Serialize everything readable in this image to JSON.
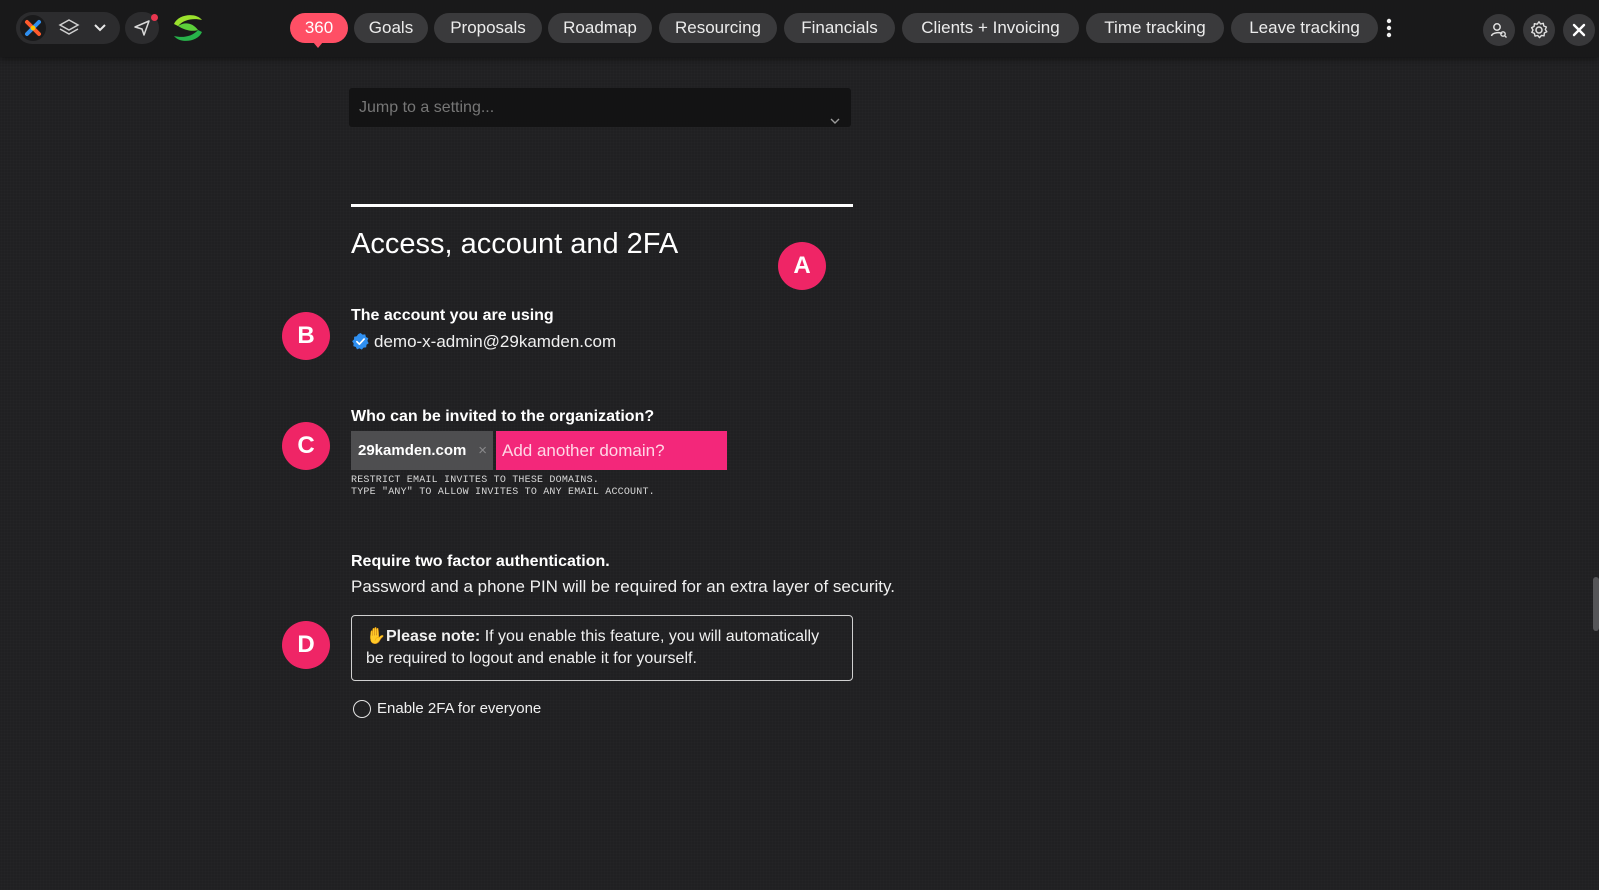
{
  "topbar": {
    "nav": [
      {
        "label": "360",
        "active": true
      },
      {
        "label": "Goals",
        "active": false
      },
      {
        "label": "Proposals",
        "active": false
      },
      {
        "label": "Roadmap",
        "active": false
      },
      {
        "label": "Resourcing",
        "active": false
      },
      {
        "label": "Financials",
        "active": false
      },
      {
        "label": "Clients + Invoicing",
        "active": false
      },
      {
        "label": "Time tracking",
        "active": false
      },
      {
        "label": "Leave tracking",
        "active": false
      }
    ],
    "icons": [
      "brand-x-icon",
      "layers-icon",
      "chevron-down-icon",
      "send-icon",
      "logo-icon",
      "more-vertical-icon",
      "user-search-icon",
      "gear-icon",
      "close-icon"
    ],
    "colors": {
      "active_pill": "#ff4f65",
      "pill": "#3a3a3c",
      "notification": "#e8364f"
    }
  },
  "settings": {
    "jump_placeholder": "Jump to a setting...",
    "section_title": "Access, account and 2FA",
    "markers": {
      "a": "A",
      "b": "B",
      "c": "C",
      "d": "D"
    },
    "account": {
      "label": "The account you are using",
      "email": "demo-x-admin@29kamden.com"
    },
    "invites": {
      "label": "Who can be invited to the organization?",
      "domain_tag": "29kamden.com",
      "tag_remove": "×",
      "input_placeholder": "Add another domain?",
      "help_line1": "RESTRICT EMAIL INVITES TO THESE DOMAINS.",
      "help_line2": "TYPE \"ANY\" TO ALLOW INVITES TO ANY EMAIL ACCOUNT."
    },
    "twofa": {
      "label": "Require two factor authentication.",
      "description": "Password and a phone PIN will be required for an extra layer of security.",
      "note_emoji": "✋",
      "note_bold": "Please note:",
      "note_text": " If you enable this feature, you will automatically be required to logout and enable it for yourself.",
      "radio_label": "Enable 2FA for everyone"
    },
    "colors": {
      "marker": "#ef2566",
      "domain_input": "#f3277a",
      "verified": "#2f8ff0"
    }
  }
}
